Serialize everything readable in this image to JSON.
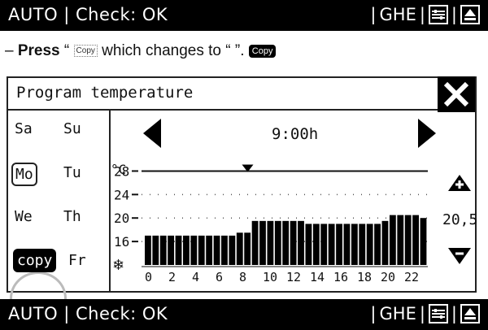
{
  "status_top": {
    "mode": "AUTO | Check: OK",
    "tag": "GHE"
  },
  "instruction": {
    "prefix": "–",
    "verb": "Press",
    "q1": "“",
    "ghost_label": "Copy",
    "middle": "which changes to “  ”.",
    "badge_label": "Copy"
  },
  "screen": {
    "title": "Program temperature",
    "days": {
      "sa": "Sa",
      "su": "Su",
      "mo": "Mo",
      "tu": "Tu",
      "we": "We",
      "th": "Th",
      "copy": "copy",
      "fr": "Fr"
    },
    "time": "9:00h",
    "setpoint": "20,5",
    "unit": "°C"
  },
  "chart_data": {
    "type": "bar",
    "ylim": [
      12,
      30
    ],
    "y_ticks": [
      "28",
      "24",
      "20",
      "16"
    ],
    "x_ticks": [
      "0",
      "2",
      "4",
      "6",
      "8",
      "10",
      "12",
      "14",
      "16",
      "18",
      "20",
      "22"
    ],
    "values": [
      17,
      17,
      17,
      17,
      17,
      17,
      17,
      17,
      17,
      17,
      17,
      17,
      17,
      17,
      17,
      17,
      17,
      17,
      17,
      17,
      17,
      17,
      17,
      17,
      17,
      17,
      17,
      17,
      17,
      17,
      17,
      17,
      17,
      17,
      17,
      17,
      17,
      17,
      17,
      17,
      17,
      17,
      17,
      17,
      17,
      17,
      17,
      17,
      17,
      17,
      17,
      17,
      17,
      17,
      17,
      17,
      17,
      17,
      17,
      17,
      17,
      17,
      17,
      17,
      17,
      17,
      17,
      17,
      17,
      17,
      17,
      17,
      17.5,
      17.5,
      17.5,
      17.5,
      17.5,
      17.5,
      17.5,
      17.5,
      19.5,
      19.5,
      19.5,
      19.5,
      19.5,
      19.5,
      19.5,
      19.5,
      20,
      20,
      20,
      20,
      20,
      20,
      20,
      20,
      20,
      20,
      20,
      20,
      20,
      20,
      20,
      20,
      19.5,
      19.5,
      19.5,
      19.5,
      19.5,
      19.5,
      19.5,
      19.5,
      19.5,
      19.5,
      19.5,
      19.5,
      19.5,
      19.5,
      19.5,
      19.5,
      19.5,
      19.5,
      19.5,
      19.5,
      19.5,
      19.5,
      19.5,
      19.5,
      19,
      19,
      19,
      19,
      19,
      19,
      19,
      19,
      19,
      19,
      19,
      19,
      19,
      19,
      19,
      19,
      19,
      19,
      19,
      19,
      19,
      19,
      19,
      19,
      19,
      19,
      19,
      19,
      19,
      19,
      19,
      19,
      19.5,
      19.5,
      19.5,
      19.5,
      19.5,
      19.5,
      19.5,
      19.5,
      20.5,
      20.5,
      20.5,
      20.5,
      20.5,
      20.5,
      20.5,
      20.5,
      20.5,
      20.5,
      20.5,
      20.5,
      20.5,
      20.5,
      20.5,
      20.5,
      20,
      20,
      20,
      20,
      20,
      20,
      20,
      20
    ],
    "bar_values": [
      17,
      17,
      17,
      17,
      17,
      17,
      17,
      17,
      17,
      17,
      17,
      17,
      17.5,
      17.5,
      19.5,
      19.5,
      19.5,
      19.5,
      19.5,
      19.5,
      19.5,
      19,
      19,
      19,
      19,
      19,
      19,
      19,
      19,
      19,
      19,
      19.5,
      20.5,
      20.5,
      20.5,
      20.5,
      20
    ],
    "cursor_x": 9,
    "setpoint_value": 20.5
  }
}
